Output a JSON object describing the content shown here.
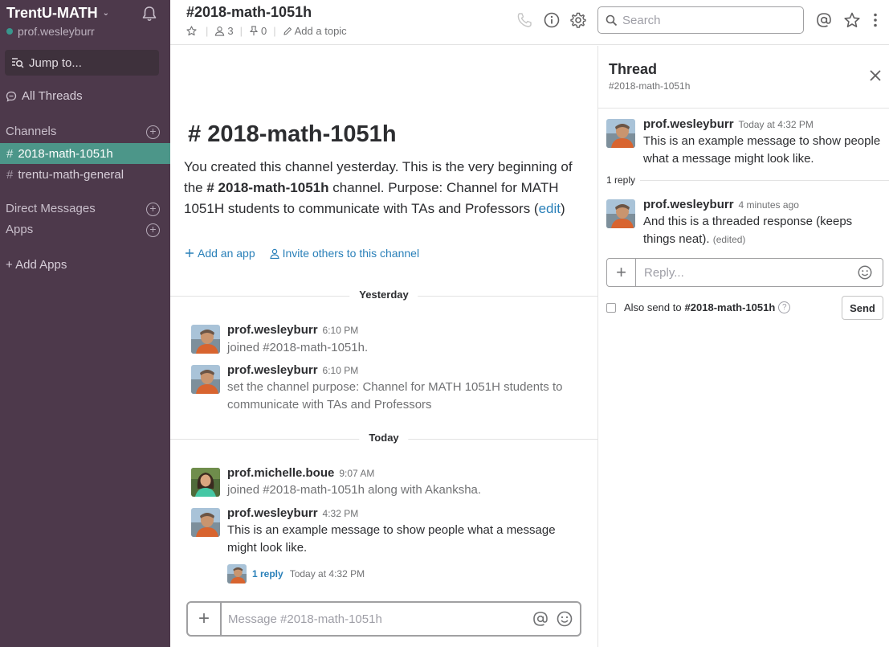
{
  "sidebar": {
    "team_name": "TrentU-MATH",
    "user_name": "prof.wesleyburr",
    "jump_to": "Jump to...",
    "all_threads": "All Threads",
    "channels_header": "Channels",
    "channels": [
      {
        "name": "2018-math-1051h",
        "active": true
      },
      {
        "name": "trentu-math-general",
        "active": false
      }
    ],
    "direct_messages_header": "Direct Messages",
    "apps_header": "Apps",
    "add_apps": "+ Add Apps",
    "colors": {
      "background": "#4d394b",
      "active_channel": "#4c9689",
      "presence": "#38978d"
    }
  },
  "header": {
    "channel_title": "#2018-math-1051h",
    "member_count": "3",
    "pinned_count": "0",
    "add_topic": "Add a topic",
    "search_placeholder": "Search",
    "icons": [
      "call-icon",
      "info-icon",
      "settings-icon",
      "mention-icon",
      "star-icon",
      "more-icon"
    ]
  },
  "intro": {
    "title": "2018-math-1051h",
    "text_1": "You created this channel yesterday. This is the very beginning of the ",
    "channel_name": "2018-math-1051h",
    "text_2": " channel. Purpose: Channel for MATH 1051H students to communicate with TAs and Professors (",
    "edit_link": "edit",
    "text_3": ")",
    "add_app": "Add an app",
    "invite": "Invite others to this channel"
  },
  "messages": {
    "day_yesterday": "Yesterday",
    "day_today": "Today",
    "items": [
      {
        "author": "prof.wesleyburr",
        "time": "6:10 PM",
        "text": "joined #2018-math-1051h."
      },
      {
        "author": "prof.wesleyburr",
        "time": "6:10 PM",
        "text": "set the channel purpose: Channel for MATH 1051H students to communicate with TAs and Professors"
      },
      {
        "author": "prof.michelle.boue",
        "time": "9:07 AM",
        "text": "joined #2018-math-1051h along with Akanksha."
      },
      {
        "author": "prof.wesleyburr",
        "time": "4:32 PM",
        "text": "This is an example message to show people what a message might look like."
      }
    ],
    "reply_count": "1 reply",
    "reply_time": "Today at 4:32 PM"
  },
  "composer": {
    "placeholder": "Message #2018-math-1051h"
  },
  "thread": {
    "title": "Thread",
    "channel": "#2018-math-1051h",
    "parent": {
      "author": "prof.wesleyburr",
      "time": "Today at 4:32 PM",
      "text": "This is an example message to show people what a message might look like."
    },
    "replies_label": "1 reply",
    "reply": {
      "author": "prof.wesleyburr",
      "time": "4 minutes ago",
      "text": "And this is a threaded response (keeps things neat).",
      "edited": "(edited)"
    },
    "reply_placeholder": "Reply...",
    "also_send_label": "Also send to",
    "also_send_channel": "#2018-math-1051h",
    "help": "?",
    "send_label": "Send"
  }
}
